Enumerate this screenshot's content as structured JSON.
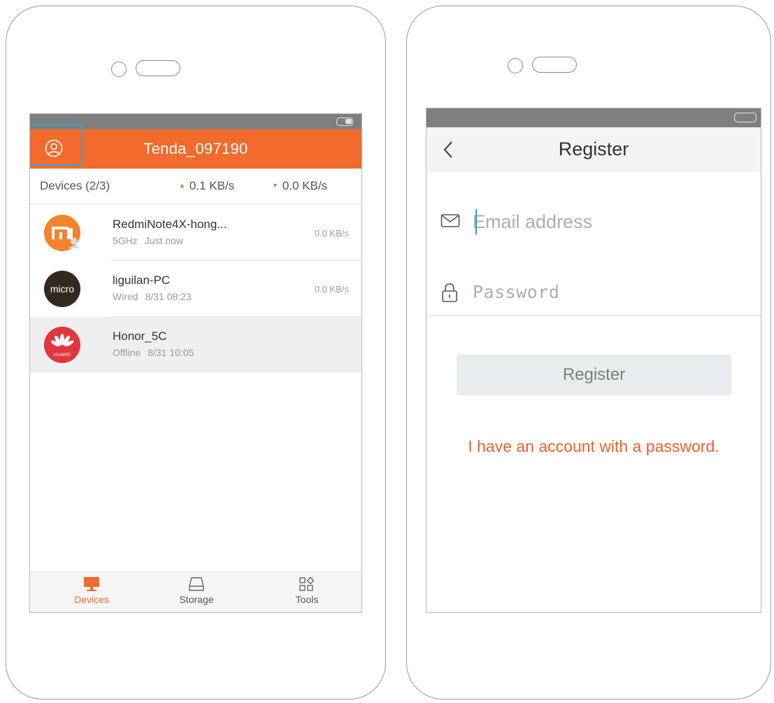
{
  "colors": {
    "brand_orange": "#f26a2c",
    "highlight_blue": "#3ba0df",
    "upload_triangle": "#f26a2c",
    "download_triangle": "#3cba6a",
    "link_orange": "#e8622b",
    "caret_cyan": "#1aa9c8",
    "statusbar_gray": "#7f7f7f"
  },
  "left_app": {
    "title": "Tenda_097190",
    "devices_label": "Devices (2/3)",
    "upload_rate": "0.1  KB/s",
    "download_rate": "0.0  KB/s",
    "devices": [
      {
        "name": "RedmiNote4X-hong...",
        "connection": "5GHz",
        "time": "Just now",
        "speed": "0.0  KB/s",
        "icon": "mi-logo-icon",
        "status": "online"
      },
      {
        "name": "liguilan-PC",
        "connection": "Wired",
        "time": "8/31 08:23",
        "speed": "0.0  KB/s",
        "icon_text": "micro",
        "icon": "microsoft-logo-icon",
        "status": "online"
      },
      {
        "name": "Honor_5C",
        "connection": "Offline",
        "time": "8/31 10:05",
        "speed": "",
        "icon_text": "HUAWEI",
        "icon": "huawei-logo-icon",
        "status": "offline"
      }
    ],
    "tabs": [
      {
        "label": "Devices",
        "icon": "monitor-icon",
        "active": true
      },
      {
        "label": "Storage",
        "icon": "disk-icon",
        "active": false
      },
      {
        "label": "Tools",
        "icon": "grid-icon",
        "active": false
      }
    ]
  },
  "right_app": {
    "title": "Register",
    "email_placeholder": "Email address",
    "password_placeholder": "Password",
    "register_label": "Register",
    "account_link": "I have an account with a password."
  }
}
